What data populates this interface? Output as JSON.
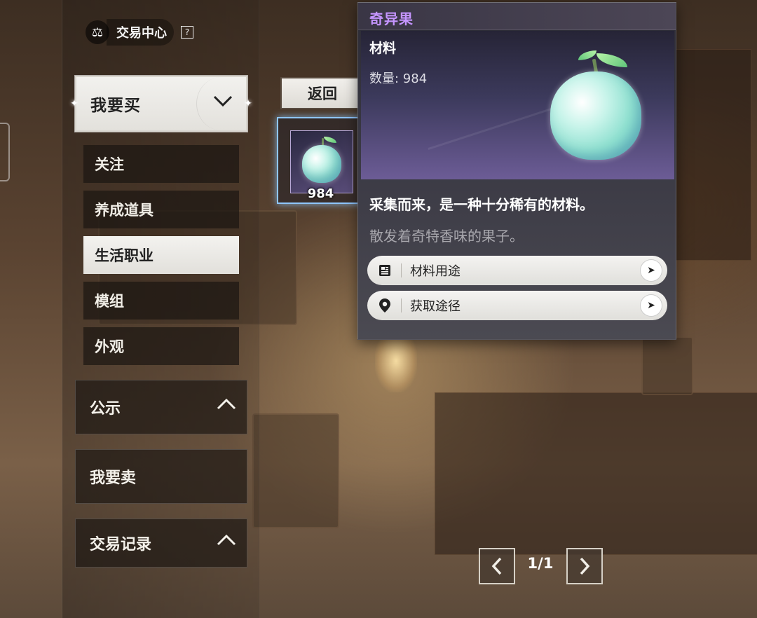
{
  "header": {
    "title": "交易中心",
    "help_glyph": "?"
  },
  "sidebar": {
    "buy_select": {
      "label": "我要买"
    },
    "buy_categories": [
      {
        "label": "关注",
        "active": false
      },
      {
        "label": "养成道具",
        "active": false
      },
      {
        "label": "生活职业",
        "active": true
      },
      {
        "label": "模组",
        "active": false
      },
      {
        "label": "外观",
        "active": false
      }
    ],
    "sections": [
      {
        "label": "公示",
        "has_chevron": true
      },
      {
        "label": "我要卖",
        "has_chevron": false
      },
      {
        "label": "交易记录",
        "has_chevron": true
      }
    ]
  },
  "main": {
    "back_label": "返回",
    "item_slot": {
      "quantity": "984"
    }
  },
  "tooltip": {
    "name": "奇异果",
    "type": "材料",
    "count_label": "数量: 984",
    "description": "采集而来，是一种十分稀有的材料。",
    "flavor": "散发着奇特香味的果子。",
    "actions": [
      {
        "label": "材料用途",
        "icon": "list-icon"
      },
      {
        "label": "获取途径",
        "icon": "location-pin-icon"
      }
    ],
    "colors": {
      "name": "#c595ff"
    }
  },
  "pagination": {
    "text": "1/1",
    "prev": "‹",
    "next": "›"
  }
}
